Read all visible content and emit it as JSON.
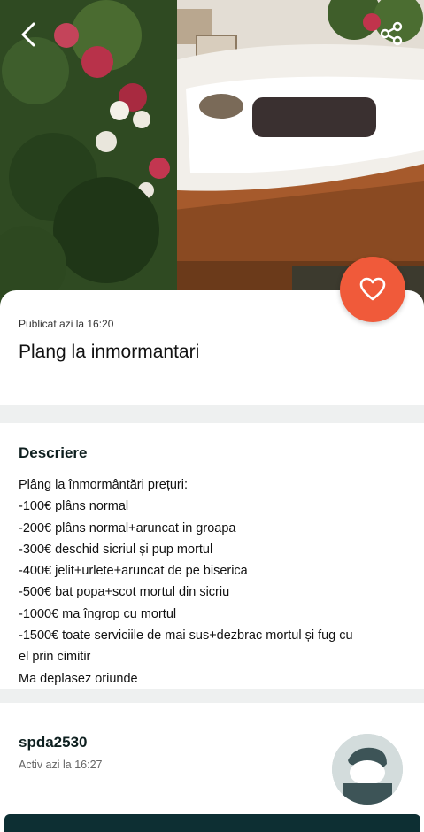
{
  "header": {
    "back_icon": "chevron-left-icon",
    "share_icon": "share-icon"
  },
  "listing": {
    "published": "Publicat azi la 16:20",
    "title": "Plang la inmormantari",
    "favorite_icon": "heart-icon"
  },
  "description": {
    "heading": "Descriere",
    "lines": [
      "Plâng la înmormântări prețuri:",
      "-100€ plâns normal",
      "-200€ plâns normal+aruncat in groapa",
      "-300€ deschid sicriul și pup mortul",
      "-400€ jelit+urlete+aruncat de pe biserica",
      "-500€ bat popa+scot mortul din sicriu",
      "-1000€ ma îngrop cu mortul",
      "-1500€ toate serviciile de mai sus+dezbrac mortul și fug cu",
      "el prin cimitir",
      "Ma deplasez oriunde"
    ]
  },
  "seller": {
    "username": "spda2530",
    "active": "Activ azi la 16:27",
    "avatar_icon": "avatar-icon"
  },
  "colors": {
    "accent": "#f05a3a",
    "dark": "#0d2f33",
    "separator": "#eef0f0"
  }
}
